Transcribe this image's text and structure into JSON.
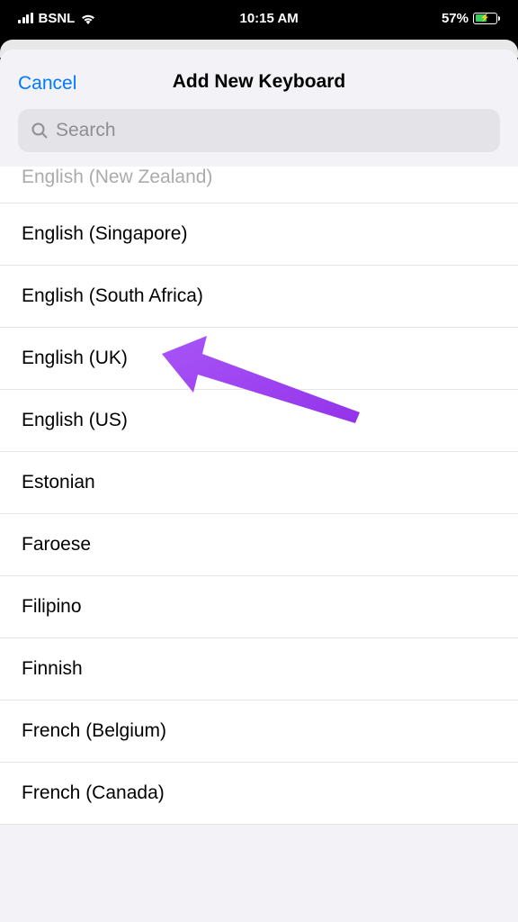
{
  "statusBar": {
    "carrier": "BSNL",
    "time": "10:15 AM",
    "batteryPercent": "57%"
  },
  "header": {
    "cancel": "Cancel",
    "title": "Add New Keyboard"
  },
  "search": {
    "placeholder": "Search"
  },
  "keyboards": [
    "English (New Zealand)",
    "English (Singapore)",
    "English (South Africa)",
    "English (UK)",
    "English (US)",
    "Estonian",
    "Faroese",
    "Filipino",
    "Finnish",
    "French (Belgium)",
    "French (Canada)"
  ]
}
